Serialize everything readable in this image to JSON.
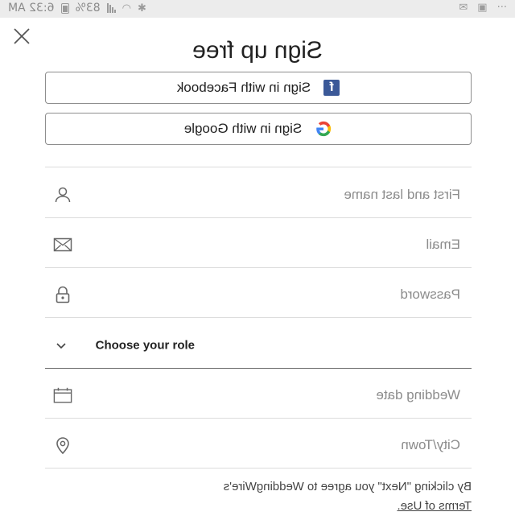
{
  "status_bar": {
    "time": "6:32 AM",
    "battery": "83%"
  },
  "header": {
    "title": "Sign up free",
    "close_icon": "close-icon"
  },
  "social": {
    "facebook_label": "Sign in with Facebook",
    "google_label": "Sign in with Google",
    "facebook_color": "#3b5998"
  },
  "form": {
    "name_placeholder": "First and last name",
    "email_placeholder": "Email",
    "password_placeholder": "Password",
    "role_label": "Choose your role",
    "wedding_date_placeholder": "Wedding date",
    "city_placeholder": "City/Town"
  },
  "footer": {
    "terms_text": "By clicking \"Next\" you agree to WeddingWire's",
    "terms_link": "Terms of Use."
  }
}
